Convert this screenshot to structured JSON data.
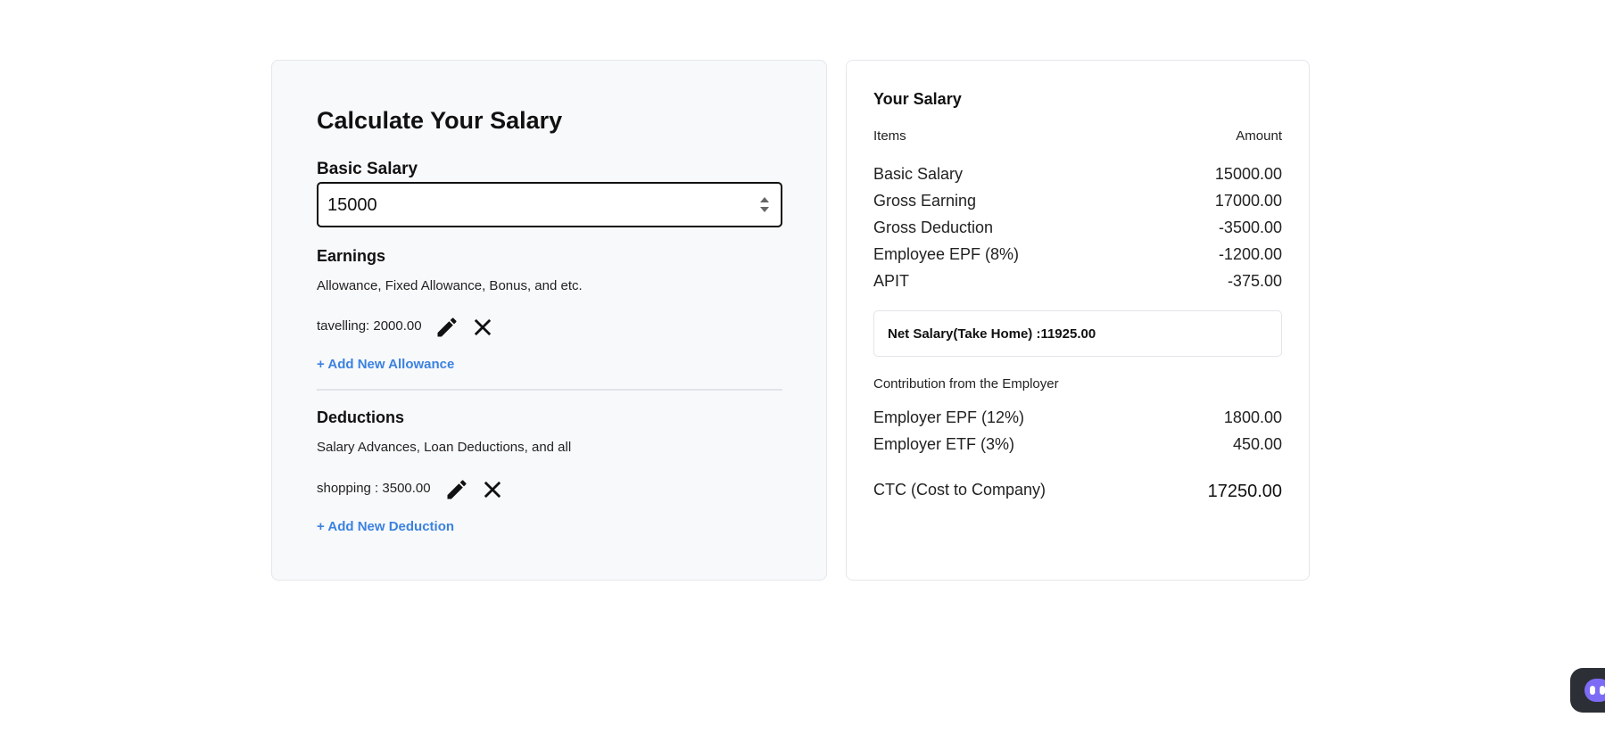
{
  "calculator": {
    "title": "Calculate Your Salary",
    "basic_salary_label": "Basic Salary",
    "basic_salary_value": "15000",
    "earnings": {
      "heading": "Earnings",
      "description": "Allowance, Fixed Allowance, Bonus, and etc.",
      "items": [
        {
          "text": "tavelling: 2000.00"
        }
      ],
      "add_label": "+ Add New Allowance"
    },
    "deductions": {
      "heading": "Deductions",
      "description": "Salary Advances, Loan Deductions, and all",
      "items": [
        {
          "text": "shopping : 3500.00"
        }
      ],
      "add_label": "+ Add New Deduction"
    }
  },
  "summary": {
    "title": "Your Salary",
    "col_items": "Items",
    "col_amount": "Amount",
    "rows": [
      {
        "label": "Basic Salary",
        "value": "15000.00"
      },
      {
        "label": "Gross Earning",
        "value": "17000.00"
      },
      {
        "label": "Gross Deduction",
        "value": "-3500.00"
      },
      {
        "label": "Employee EPF (8%)",
        "value": "-1200.00"
      },
      {
        "label": "APIT",
        "value": "-375.00"
      }
    ],
    "net_salary": "Net Salary(Take Home) :11925.00",
    "employer_heading": "Contribution from the Employer",
    "employer_rows": [
      {
        "label": "Employer EPF (12%)",
        "value": "1800.00"
      },
      {
        "label": "Employer ETF (3%)",
        "value": "450.00"
      }
    ],
    "ctc_label": "CTC (Cost to Company)",
    "ctc_value": "17250.00"
  },
  "icons": {
    "edit": "pencil-icon",
    "delete": "close-icon",
    "chat": "chat-bot-icon"
  },
  "colors": {
    "link": "#3b82e0",
    "panel_bg": "#f8f9fb",
    "border": "#e4e7eb"
  }
}
